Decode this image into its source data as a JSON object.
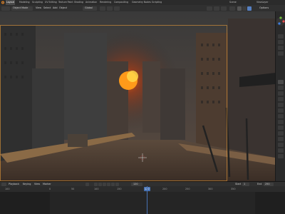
{
  "menu": {
    "items": [
      {
        "label": "Layout"
      },
      {
        "label": "Modeling"
      },
      {
        "label": "Sculpting"
      },
      {
        "label": "UV Editing"
      },
      {
        "label": "Texture Paint"
      },
      {
        "label": "Shading"
      },
      {
        "label": "Animation"
      },
      {
        "label": "Rendering"
      },
      {
        "label": "Compositing"
      },
      {
        "label": "Geometry Nodes"
      },
      {
        "label": "Scripting"
      }
    ],
    "right_label": "Scene",
    "right_label2": "ViewLayer"
  },
  "header": {
    "mode": "Object Mode",
    "view": "View",
    "select": "Select",
    "add": "Add",
    "object": "Object",
    "orientation": "Global",
    "options": "Options"
  },
  "viewport": {
    "shading": "rendered",
    "sun_color": "#ff9a1a"
  },
  "timeline": {
    "playback": "Playback",
    "keying": "Keying",
    "view": "View",
    "marker": "Marker",
    "current_frame": "120",
    "start_label": "Start",
    "start": "1",
    "end_label": "End",
    "end": "250",
    "ruler": [
      "100",
      "0",
      "50",
      "100",
      "150",
      "200",
      "250",
      "300",
      "350"
    ]
  }
}
